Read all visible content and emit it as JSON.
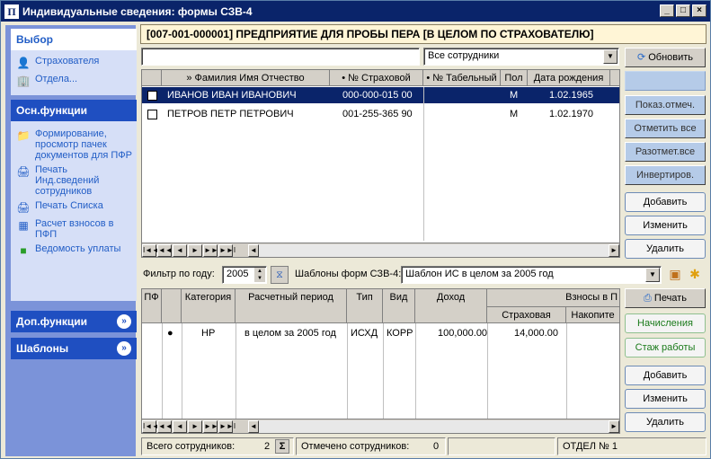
{
  "window": {
    "title": "Индивидуальные сведения: формы СЗВ-4",
    "app_icon": "П",
    "min": "_",
    "max": "□",
    "close": "×"
  },
  "sidebar": {
    "select_panel": {
      "title": "Выбор",
      "items": [
        {
          "label": "Страхователя",
          "icon": "user-icon"
        },
        {
          "label": "Отдела...",
          "icon": "org-icon"
        }
      ]
    },
    "main_panel": {
      "title": "Осн.функции",
      "items": [
        {
          "label": "Формирование, просмотр пачек документов для ПФР",
          "icon": "docs-icon"
        },
        {
          "label": "Печать Инд.сведений сотрудников",
          "icon": "printer-icon"
        },
        {
          "label": "Печать Списка",
          "icon": "printer-icon"
        },
        {
          "label": "Расчет взносов в ПФП",
          "icon": "calc-icon"
        },
        {
          "label": "Ведомость уплаты",
          "icon": "book-icon"
        }
      ]
    },
    "extra_panel": {
      "title": "Доп.функции"
    },
    "templates_panel": {
      "title": "Шаблоны"
    }
  },
  "header": {
    "title": "[007-001-000001] ПРЕДПРИЯТИЕ ДЛЯ ПРОБЫ ПЕРА [В ЦЕЛОМ ПО СТРАХОВАТЕЛЮ]"
  },
  "search": {
    "value": ""
  },
  "filter_combo": {
    "value": "Все сотрудники"
  },
  "right_buttons": {
    "refresh": "Обновить",
    "show_marked": "Показ.отмеч.",
    "mark_all": "Отметить все",
    "unmark_all": "Разотмет.все",
    "invert": "Инвертиров.",
    "add": "Добавить",
    "edit": "Изменить",
    "delete": "Удалить"
  },
  "employees": {
    "columns": [
      "» Фамилия Имя Отчество",
      "• № Страховой",
      "• № Табельный",
      "Пол",
      "Дата рождения"
    ],
    "rows": [
      {
        "name": "ИВАНОВ ИВАН ИВАНОВИЧ",
        "ins": "000-000-015 00",
        "tab": "",
        "sex": "М",
        "dob": "1.02.1965"
      },
      {
        "name": "ПЕТРОВ ПЕТР ПЕТРОВИЧ",
        "ins": "001-255-365 90",
        "tab": "",
        "sex": "М",
        "dob": "1.02.1970"
      }
    ]
  },
  "year_filter": {
    "label": "Фильтр по году:",
    "value": "2005"
  },
  "templates": {
    "label": "Шаблоны форм СЗВ-4:",
    "value": "Шаблон ИС в целом за 2005 год"
  },
  "forms_buttons": {
    "print": "Печать",
    "accruals": "Начисления",
    "experience": "Стаж работы",
    "add": "Добавить",
    "edit": "Изменить",
    "delete": "Удалить"
  },
  "forms": {
    "columns": [
      "ПФ",
      "Категория",
      "Расчетный период",
      "Тип",
      "Вид",
      "Доход"
    ],
    "group_header": "Взносы в П",
    "sub_columns": [
      "Страховая",
      "Накопите"
    ],
    "rows": [
      {
        "pf": "",
        "marker": "●",
        "category": "НР",
        "period": "в целом за 2005 год",
        "type": "ИСХД",
        "kind": "КОРР",
        "income": "100,000.00",
        "insurance": "14,000.00",
        "savings": ""
      }
    ]
  },
  "status": {
    "total_label": "Всего сотрудников:",
    "total_value": "2",
    "sum_icon": "Σ",
    "marked_label": "Отмечено сотрудников:",
    "marked_value": "0",
    "dept": "ОТДЕЛ № 1"
  },
  "nav": {
    "first": "I◄◄",
    "prev_page": "◄◄",
    "prev": "◄",
    "next": "►",
    "next_page": "►►",
    "last": "►►I"
  }
}
